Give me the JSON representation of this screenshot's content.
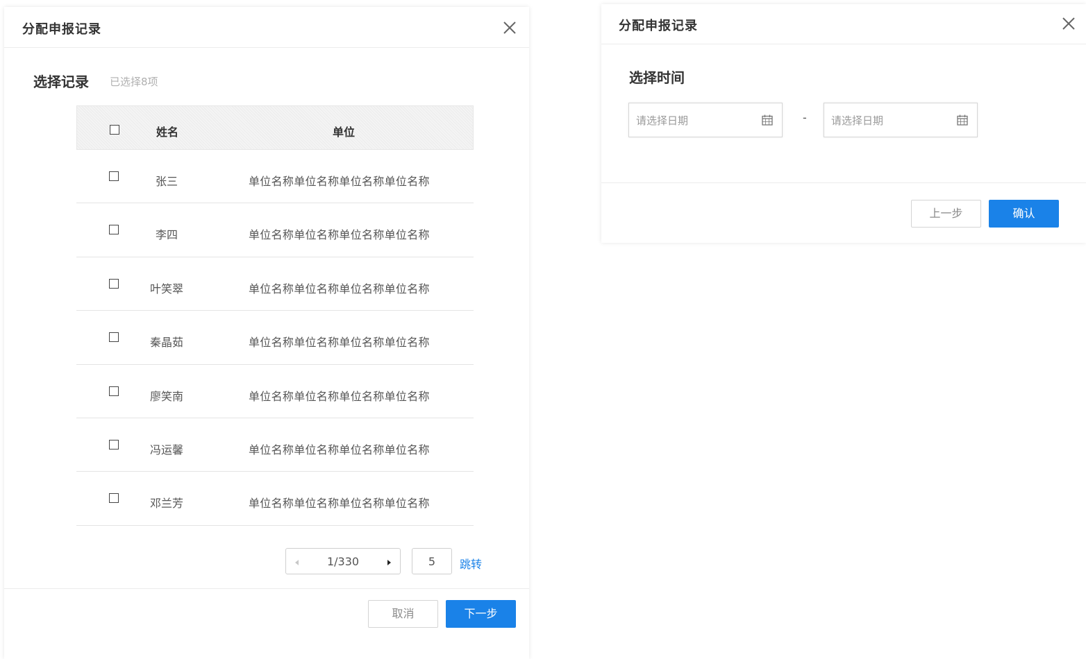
{
  "left_dialog": {
    "title": "分配申报记录",
    "section_title": "选择记录",
    "selected_count": "已选择8项",
    "table": {
      "headers": {
        "name": "姓名",
        "unit": "单位"
      },
      "rows": [
        {
          "name": "张三",
          "unit": "单位名称单位名称单位名称单位名称"
        },
        {
          "name": "李四",
          "unit": "单位名称单位名称单位名称单位名称"
        },
        {
          "name": "叶笑翠",
          "unit": "单位名称单位名称单位名称单位名称"
        },
        {
          "name": "秦晶茹",
          "unit": "单位名称单位名称单位名称单位名称"
        },
        {
          "name": "廖笑南",
          "unit": "单位名称单位名称单位名称单位名称"
        },
        {
          "name": "冯运馨",
          "unit": "单位名称单位名称单位名称单位名称"
        },
        {
          "name": "邓兰芳",
          "unit": "单位名称单位名称单位名称单位名称"
        }
      ]
    },
    "pager": {
      "text": "1/330",
      "jump_value": "5",
      "jump_label": "跳转"
    },
    "buttons": {
      "cancel": "取消",
      "next": "下一步"
    }
  },
  "right_dialog": {
    "title": "分配申报记录",
    "section_title": "选择时间",
    "start_date_placeholder": "请选择日期",
    "end_date_placeholder": "请选择日期",
    "range_separator": "-",
    "buttons": {
      "prev": "上一步",
      "confirm": "确认"
    }
  },
  "colors": {
    "primary": "#1a82e8",
    "border": "#d4d4d4",
    "muted_text": "#b0b0b0"
  },
  "icons": {
    "close": "close-icon",
    "calendar": "calendar-icon",
    "checkbox": "checkbox",
    "pager_prev": "triangle-left-icon",
    "pager_next": "triangle-right-icon"
  }
}
